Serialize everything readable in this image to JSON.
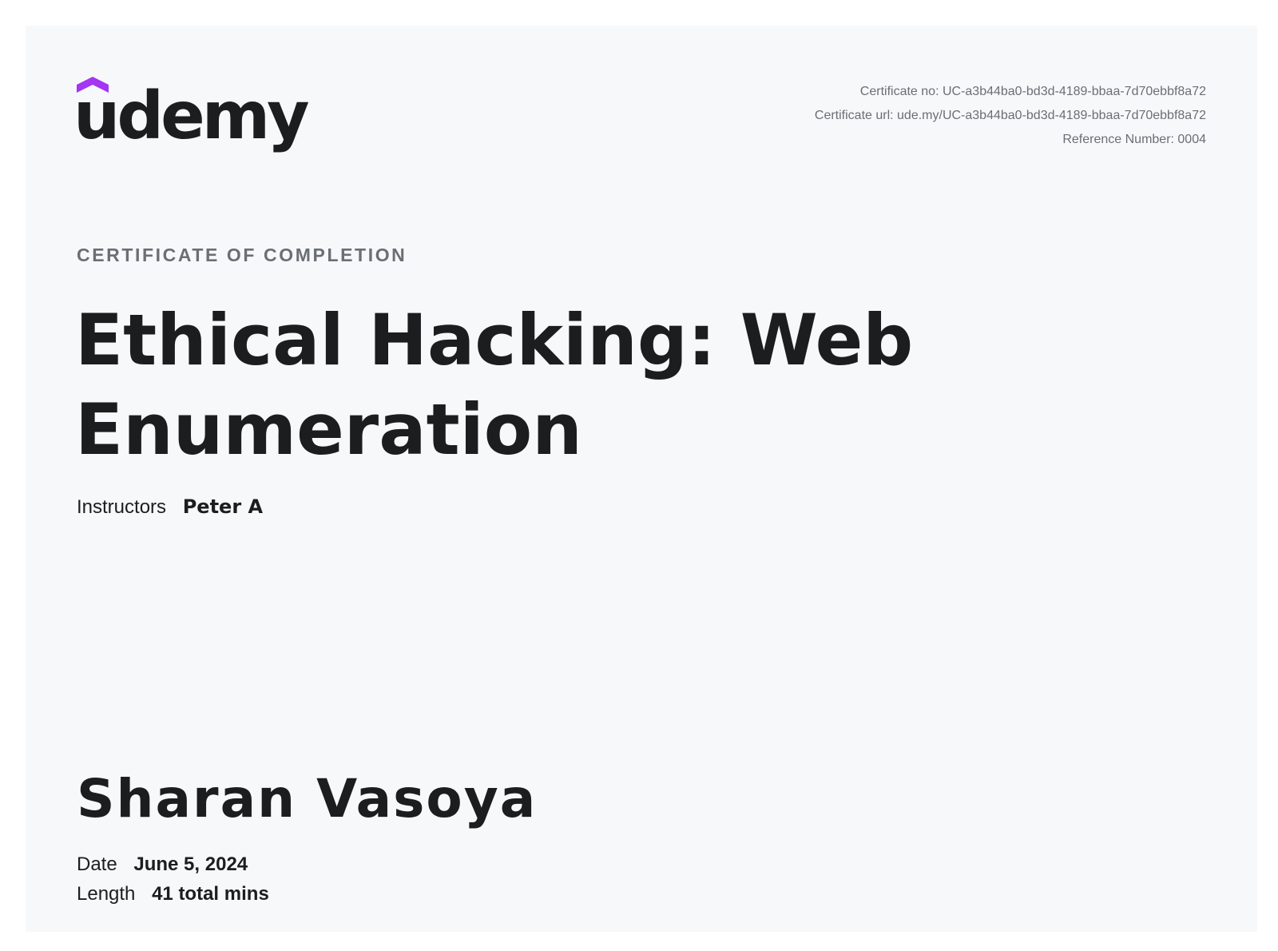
{
  "brand": {
    "logo_text": "udemy",
    "logo_icon": "udemy-chevron-icon",
    "accent": "#a435f0"
  },
  "certificate": {
    "number_line": "Certificate no: UC-a3b44ba0-bd3d-4189-bbaa-7d70ebbf8a72",
    "url_line": "Certificate url: ude.my/UC-a3b44ba0-bd3d-4189-bbaa-7d70ebbf8a72",
    "reference_line": "Reference Number: 0004",
    "heading": "CERTIFICATE OF COMPLETION"
  },
  "course": {
    "title": "Ethical Hacking: Web Enumeration",
    "instructors_label": "Instructors",
    "instructors_value": "Peter A"
  },
  "recipient": {
    "name": "Sharan Vasoya",
    "date_label": "Date",
    "date_value": "June 5, 2024",
    "length_label": "Length",
    "length_value": "41 total mins"
  }
}
